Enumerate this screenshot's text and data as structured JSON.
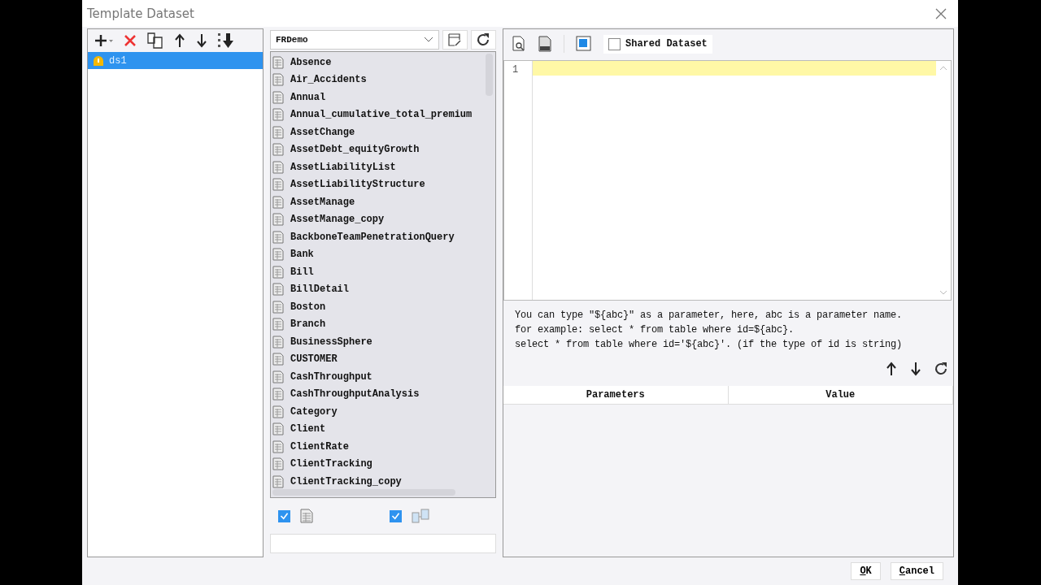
{
  "window": {
    "title": "Template Dataset"
  },
  "datasets": [
    {
      "label": "ds1",
      "selected": true
    }
  ],
  "connection": {
    "value": "FRDemo"
  },
  "tables": [
    "Absence",
    "Air_Accidents",
    "Annual",
    "Annual_cumulative_total_premium",
    "AssetChange",
    "AssetDebt_equityGrowth",
    "AssetLiabilityList",
    "AssetLiabilityStructure",
    "AssetManage",
    "AssetManage_copy",
    "BackboneTeamPenetrationQuery",
    "Bank",
    "Bill",
    "BillDetail",
    "Boston",
    "Branch",
    "BusinessSphere",
    "CUSTOMER",
    "CashThroughput",
    "CashThroughputAnalysis",
    "Category",
    "Client",
    "ClientRate",
    "ClientTracking",
    "ClientTracking_copy"
  ],
  "shared_dataset": {
    "label": "Shared Dataset",
    "checked": false
  },
  "editor": {
    "line_numbers": [
      "1"
    ]
  },
  "hint_lines": [
    "You can type \"${abc}\" as a parameter, here, abc is a parameter name.",
    "for example: select * from table where id=${abc}.",
    "select * from table where id='${abc}'. (if the type of id is string)"
  ],
  "parameters": {
    "columns": [
      "Parameters",
      "Value"
    ]
  },
  "filters": [
    {
      "kind": "table",
      "checked": true
    },
    {
      "kind": "view",
      "checked": true
    }
  ],
  "buttons": [
    "OK",
    "Cancel"
  ]
}
